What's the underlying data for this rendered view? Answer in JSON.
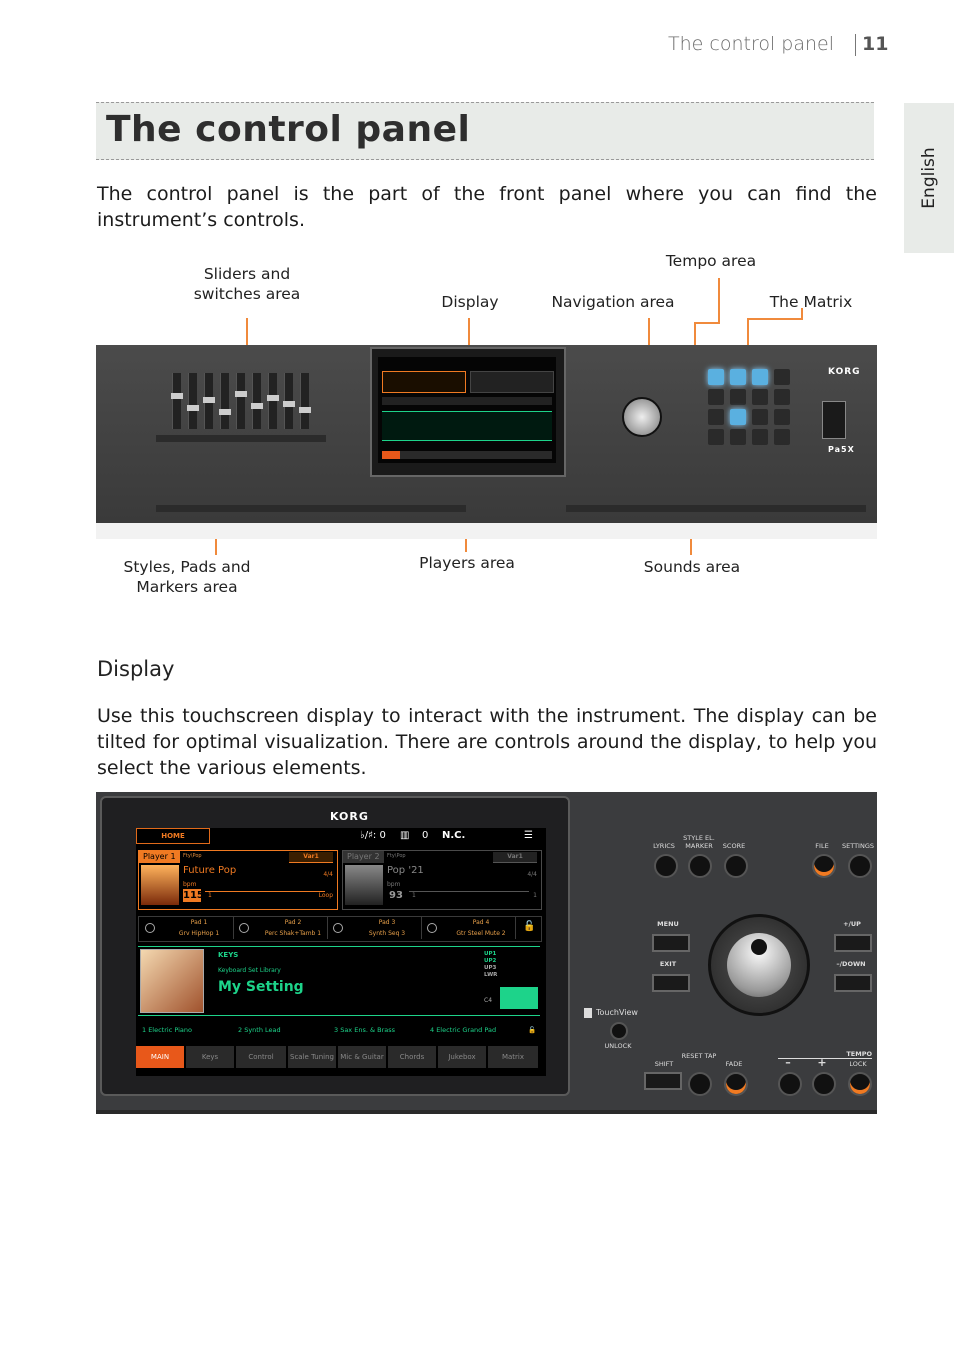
{
  "header": {
    "running_head": "The control panel",
    "page_number": "11"
  },
  "side_tab": {
    "label": "English"
  },
  "title": "The control panel",
  "intro": "The control panel is the part of the front panel where you can find the instrument’s controls.",
  "callouts": {
    "sliders": "Sliders and switches area",
    "display": "Display",
    "navigation": "Navigation area",
    "tempo": "Tempo area",
    "matrix": "The Matrix",
    "styles": "Styles, Pads and Markers area",
    "players": "Players area",
    "sounds": "Sounds area"
  },
  "panel": {
    "brand": "KORG",
    "model": "Pa5X"
  },
  "display_section": {
    "heading": "Display",
    "paragraph": "Use this touchscreen display to interact with the instrument. The display can be tilted for optimal visualization. There are controls around the display, to help you select the various elements."
  },
  "screen": {
    "brand": "KORG",
    "home": "HOME",
    "transpose": "♭/♯: 0",
    "octave": "0",
    "chord": "N.C.",
    "player1": {
      "label": "Player 1",
      "category": "Fty\\Pop",
      "variation": "Var1",
      "style": "Future Pop",
      "meter": "4/4",
      "bpm_label": "bpm",
      "tempo": "115",
      "measure": "1",
      "mode": "Loop"
    },
    "player2": {
      "label": "Player 2",
      "category": "Fty\\Pop",
      "variation": "Var1",
      "style": "Pop '21",
      "meter": "4/4",
      "bpm_label": "bpm",
      "tempo": "93",
      "measure": "1",
      "end": "1"
    },
    "pads": [
      {
        "name": "Pad 1",
        "value": "Grv HipHop 1"
      },
      {
        "name": "Pad 2",
        "value": "Perc Shak+Tamb 1"
      },
      {
        "name": "Pad 3",
        "value": "Synth Seq 3"
      },
      {
        "name": "Pad 4",
        "value": "Gtr Steel Mute 2"
      }
    ],
    "keys": {
      "heading": "KEYS",
      "library": "Keyboard Set Library",
      "name": "My Setting",
      "up1": "UP1",
      "up2": "UP2",
      "up3": "UP3",
      "lwr": "LWR",
      "note": "C4"
    },
    "sounds": [
      "1  Electric Piano",
      "2  Synth Lead",
      "3  Sax Ens. & Brass",
      "4  Electric Grand Pad"
    ],
    "tabs": [
      "MAIN",
      "Keys",
      "Control",
      "Scale Tuning",
      "Mic & Guitar",
      "Chords",
      "Jukebox",
      "Matrix"
    ]
  },
  "controls": {
    "lyrics": "LYRICS",
    "style_marker": "STYLE EL. MARKER",
    "score": "SCORE",
    "file": "FILE",
    "settings": "SETTINGS",
    "menu": "MENU",
    "exit": "EXIT",
    "up": "+/UP",
    "down": "–/DOWN",
    "touchview": "TouchView",
    "unlock": "UNLOCK",
    "shift": "SHIFT",
    "reset_tap": "RESET TAP",
    "fade": "FADE",
    "tempo": "TEMPO",
    "minus": "–",
    "plus": "+",
    "lock": "LOCK"
  }
}
